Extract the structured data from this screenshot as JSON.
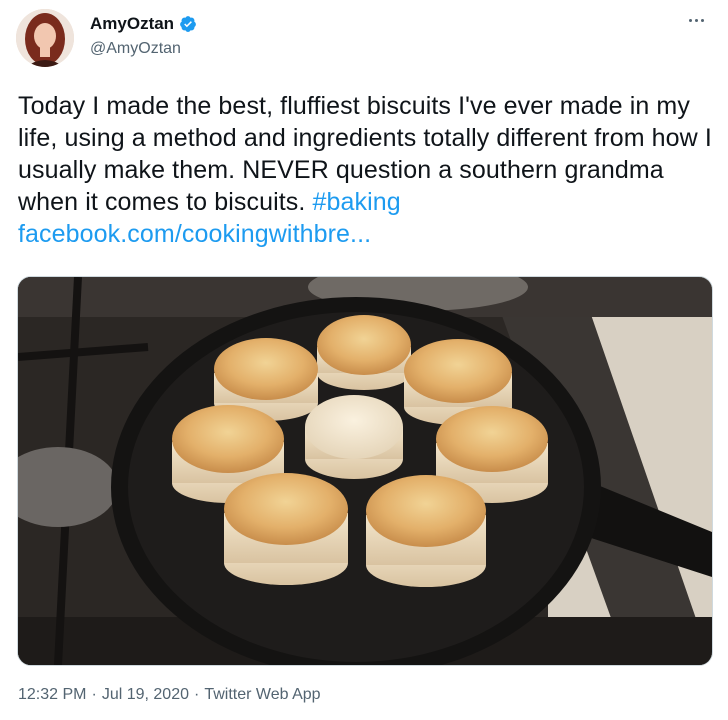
{
  "user": {
    "display_name": "AmyOztan",
    "handle": "@AmyOztan",
    "verified": true
  },
  "tweet": {
    "text": "Today I made the best, fluffiest biscuits I've ever made in my life, using a method and ingredients totally different from how I usually make them. NEVER question a southern grandma when it comes to biscuits.",
    "hashtag": "#baking",
    "link": "facebook.com/cookingwithbre..."
  },
  "meta": {
    "time": "12:32 PM",
    "date": "Jul 19, 2020",
    "source": "Twitter Web App",
    "separator": "·"
  },
  "icons": {
    "verified": "verified-badge-icon",
    "more": "more-options-icon"
  },
  "colors": {
    "link": "#1d9bf0",
    "secondary_text": "#536471"
  }
}
